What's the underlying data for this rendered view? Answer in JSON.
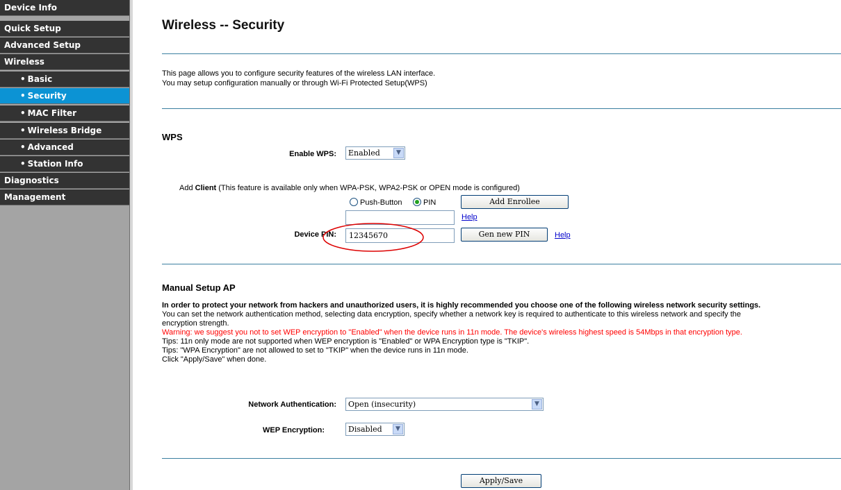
{
  "sidebar": {
    "items": [
      {
        "label": "Device Info",
        "sub": false,
        "active": false
      },
      {
        "label": "Quick Setup",
        "sub": false,
        "active": false
      },
      {
        "label": "Advanced Setup",
        "sub": false,
        "active": false
      },
      {
        "label": "Wireless",
        "sub": false,
        "active": false
      },
      {
        "label": "Basic",
        "sub": true,
        "active": false
      },
      {
        "label": "Security",
        "sub": true,
        "active": true
      },
      {
        "label": "MAC Filter",
        "sub": true,
        "active": false
      },
      {
        "label": "Wireless Bridge",
        "sub": true,
        "active": false
      },
      {
        "label": "Advanced",
        "sub": true,
        "active": false
      },
      {
        "label": "Station Info",
        "sub": true,
        "active": false
      },
      {
        "label": "Diagnostics",
        "sub": false,
        "active": false
      },
      {
        "label": "Management",
        "sub": false,
        "active": false
      }
    ]
  },
  "page": {
    "title": "Wireless -- Security",
    "intro_line1": "This page allows you to configure security features of the wireless LAN interface.",
    "intro_line2": "You may setup configuration manually or through Wi-Fi Protected Setup(WPS)"
  },
  "wps": {
    "heading": "WPS",
    "enable_label": "Enable WPS:",
    "enable_value": "Enabled",
    "add_client_prefix": "Add ",
    "add_client_bold": "Client",
    "add_client_note": " (This feature is available only when WPA-PSK, WPA2-PSK or OPEN mode is configured)",
    "radio_push": "Push-Button",
    "radio_pin": "PIN",
    "add_enrollee_btn": "Add Enrollee",
    "enrollee_pin_value": "",
    "help1": "Help",
    "device_pin_label": "Device PIN:",
    "device_pin_value": "12345670",
    "gen_pin_btn": "Gen new PIN",
    "help2": "Help"
  },
  "manual": {
    "heading": "Manual Setup AP",
    "bold_line": "In order to protect your network from hackers and unauthorized users, it is highly recommended you choose one of the following wireless network security settings.",
    "line1": "You can set the network authentication method, selecting data encryption, specify whether a network key is required to authenticate to this wireless network and specify the",
    "line2": "encryption strength.",
    "warning": "Warning: we suggest you not to set WEP encryption to \"Enabled\" when the device runs in 11n mode. The device's wireless highest speed is 54Mbps in that encryption type.",
    "tip1": "Tips: 11n only mode are not supported when WEP encryption is \"Enabled\" or WPA Encryption type is \"TKIP\".",
    "tip2": "Tips: \"WPA Encryption\" are not allowed to set to \"TKIP\" when the device runs in 11n mode.",
    "tip3": "Click \"Apply/Save\" when done.",
    "auth_label": "Network Authentication:",
    "auth_value": "Open (insecurity)",
    "wep_label": "WEP Encryption:",
    "wep_value": "Disabled",
    "apply_btn": "Apply/Save"
  },
  "colors": {
    "menu_bg": "#333333",
    "menu_active": "#0c93d4",
    "sidebar_bg": "#a4a4a4",
    "warning": "#ff0000",
    "annotation": "#dd0000"
  }
}
